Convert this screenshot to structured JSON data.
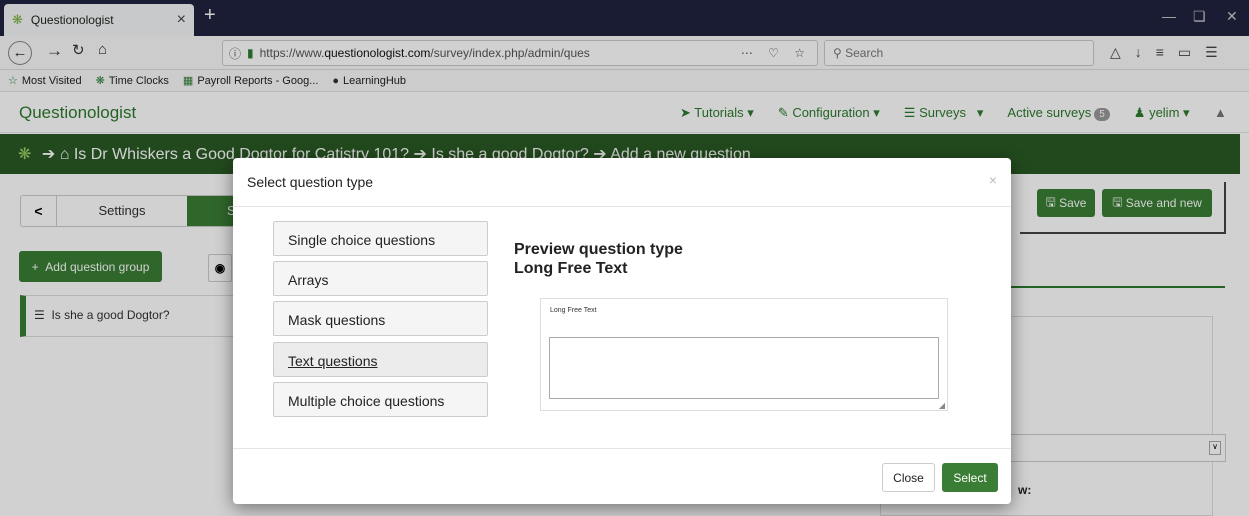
{
  "browser": {
    "tab_title": "Questionologist",
    "url_prefix": "https://www.",
    "url_domain": "questionologist.com",
    "url_path": "/survey/index.php/admin/questions/sa/newquestion",
    "search_placeholder": "Search",
    "bookmarks": [
      "Most Visited",
      "Time Clocks",
      "Payroll Reports - Goog...",
      "LearningHub"
    ]
  },
  "app": {
    "brand": "Questionologist",
    "nav": {
      "tutorials": "Tutorials",
      "configuration": "Configuration",
      "surveys": "Surveys",
      "active_surveys": "Active surveys",
      "active_count": "5",
      "user": "yelim"
    },
    "breadcrumb": "Is Dr Whiskers a Good Dogtor for Catistry 101? ➔ Is she a good Dogtor? ➔ Add a new question",
    "save_label": "Save",
    "save_new_label": "Save and new",
    "settings_tab": "Settings",
    "structure_tab": "S",
    "add_group_label": "Add question group",
    "group_name": "Is she a good Dogtor?",
    "bg_label": "w:"
  },
  "modal": {
    "title": "Select question type",
    "categories": [
      "Single choice questions",
      "Arrays",
      "Mask questions",
      "Text questions",
      "Multiple choice questions"
    ],
    "active_category": "Text questions",
    "preview_heading": "Preview question type",
    "preview_type": "Long Free Text",
    "preview_label": "Long Free Text",
    "close_label": "Close",
    "select_label": "Select"
  },
  "colors": {
    "brand_green": "#2d7a2d",
    "button_green": "#3a7d34",
    "crumb_green": "#2a5a24",
    "tabbar": "#202340"
  }
}
